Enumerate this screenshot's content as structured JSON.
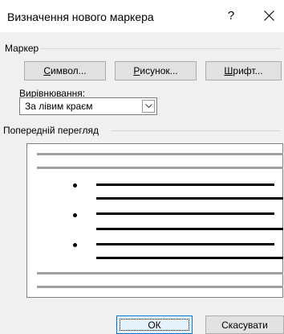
{
  "dialog": {
    "title": "Визначення нового маркера",
    "help_label": "?"
  },
  "marker_group": {
    "label": "Маркер",
    "symbol_button": {
      "accel": "С",
      "rest": "имвол..."
    },
    "picture_button": {
      "accel": "Р",
      "rest": "исунок..."
    },
    "font_button": {
      "accel": "Ш",
      "rest": "рифт..."
    }
  },
  "alignment": {
    "label_before": "Вирів",
    "label_accel": "н",
    "label_after": "ювання:",
    "selected": "За лівим краєм"
  },
  "preview": {
    "label": "Попередній перегляд",
    "bullet_count": 3
  },
  "footer": {
    "ok_label": "ОК",
    "cancel_label": "Скасувати"
  },
  "colors": {
    "ok_border": "#0078d7",
    "dialog_bg": "#f0f0f0"
  },
  "icons": [
    "close-icon",
    "chevron-down-icon",
    "bullet-icon"
  ]
}
